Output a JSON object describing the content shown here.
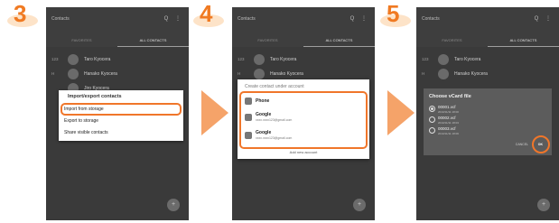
{
  "steps": [
    "3",
    "4",
    "5"
  ],
  "app": {
    "title": "Contacts",
    "toolbar_icons": "Q ⋮",
    "tabs": [
      "FAVORITES",
      "ALL CONTACTS"
    ],
    "fab_icon": "+"
  },
  "panel3": {
    "rows": [
      {
        "letter": "123",
        "name": "Taro Kyocera"
      },
      {
        "letter": "H",
        "name": "Hanako Kyocera"
      },
      {
        "letter": "",
        "name": "Jiro Kyocera"
      }
    ],
    "menu": {
      "title": "Import/export contacts",
      "items": [
        "Import from storage",
        "Export to storage",
        "Share visible contacts"
      ]
    }
  },
  "panel4": {
    "rows": [
      {
        "letter": "123",
        "name": "Taro Kyocera"
      },
      {
        "letter": "H",
        "name": "Hanako Kyocera"
      }
    ],
    "dialog": {
      "title": "Create contact under account",
      "accounts": [
        {
          "name": "Phone",
          "email": ""
        },
        {
          "name": "Google",
          "email": "xxxx.xxxx123@gmail.com"
        },
        {
          "name": "Google",
          "email": "xxxx.xxxx123@gmail.com"
        }
      ],
      "add_new": "Add new account"
    }
  },
  "panel5": {
    "rows": [
      {
        "letter": "123",
        "name": "Taro Kyocera"
      },
      {
        "letter": "H",
        "name": "Hanako Kyocera"
      }
    ],
    "dialog": {
      "title": "Choose vCard file",
      "files": [
        {
          "name": "00001.vcf",
          "date": "2013/11/11 18:00",
          "selected": true
        },
        {
          "name": "00002.vcf",
          "date": "2013/11/11 18:03",
          "selected": false
        },
        {
          "name": "00003.vcf",
          "date": "2013/11/11 18:06",
          "selected": false
        }
      ],
      "cancel": "CANCEL",
      "ok": "OK"
    }
  },
  "colors": {
    "accent": "#f07a22",
    "arrow": "#f5a369",
    "phone_bg": "#3a3a3a"
  }
}
